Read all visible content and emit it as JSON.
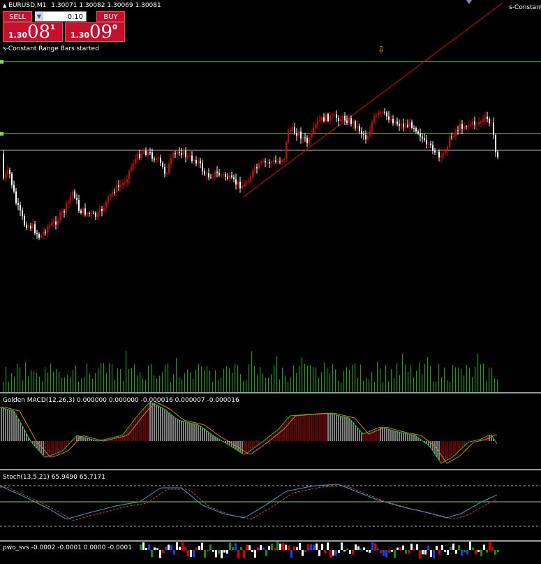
{
  "chart_header": {
    "symbol_title": "EURUSD,M1",
    "ohlc": "1.30071 1.30082 1.30069 1.30081",
    "right_label": "s-Constant"
  },
  "trade_panel": {
    "sell_label": "SELL",
    "buy_label": "BUY",
    "lots": "0.10",
    "sell_price": {
      "prefix": "1.30",
      "big": "08",
      "sup": "1"
    },
    "buy_price": {
      "prefix": "1.30",
      "big": "09",
      "sup": "0"
    }
  },
  "status_message": "s-Constant Range Bars started",
  "macd": {
    "label": "Golden MACD(12,26,3) 0.000000 0.000000 -0.000016 0.000007 -0.000016"
  },
  "stoch": {
    "label": "Stoch(13,5,21) 65.9490 65.7171"
  },
  "bottom": {
    "label": "pwo_svs -0.0002 -0.0001 0.0000 -0.0001"
  },
  "colors": {
    "bull": "#d40000",
    "bear": "#ffffff",
    "level_line": "#8fd14f",
    "bid_line": "#b8b8c8",
    "trendline": "#d40000",
    "volume": "#2f8f2f",
    "macd_main": "#1fbf1f",
    "macd_signal": "#d08020",
    "stoch_main": "#3aa0c0",
    "stoch_signal": "#d04040"
  },
  "icons": {
    "arrow": "down-arrow-icon",
    "spinner": "spinner-down-icon"
  }
}
